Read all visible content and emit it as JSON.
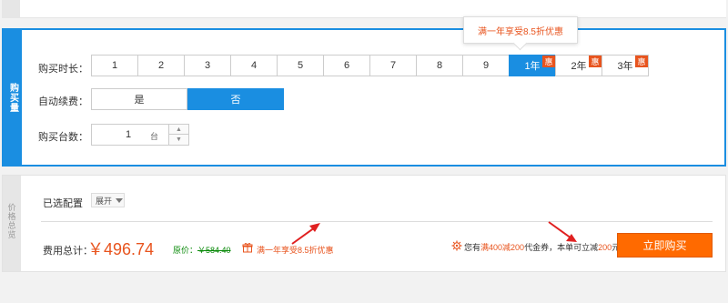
{
  "buy_section": {
    "side_label": "购买量",
    "duration": {
      "label": "购买时长：",
      "options": [
        "1",
        "2",
        "3",
        "4",
        "5",
        "6",
        "7",
        "8",
        "9",
        "1年",
        "2年",
        "3年"
      ],
      "badge": "惠",
      "tooltip": "满一年享受8.5折优惠"
    },
    "auto_renew": {
      "label": "自动续费：",
      "options": [
        "是",
        "否"
      ]
    },
    "quantity": {
      "label": "购买台数：",
      "value": "1",
      "unit": "台"
    }
  },
  "price_section": {
    "side_label": "价格总览",
    "config_label": "已选配置",
    "expand_label": "展开",
    "fee_label": "费用总计：",
    "price": "￥496.74",
    "original_label": "原价：",
    "original_price": "￥584.40",
    "promo": "满一年享受8.5折优惠",
    "coupon": {
      "part1": "您有",
      "hl1": "满400减200",
      "part2": "代金券，本单可立减",
      "hl2": "200",
      "part3": "元"
    },
    "buy_button": "立即购买"
  },
  "colors": {
    "accent": "#1a8ee1",
    "orange": "#ff6a00",
    "promo": "#e8541e",
    "green": "#0a8a0a"
  }
}
